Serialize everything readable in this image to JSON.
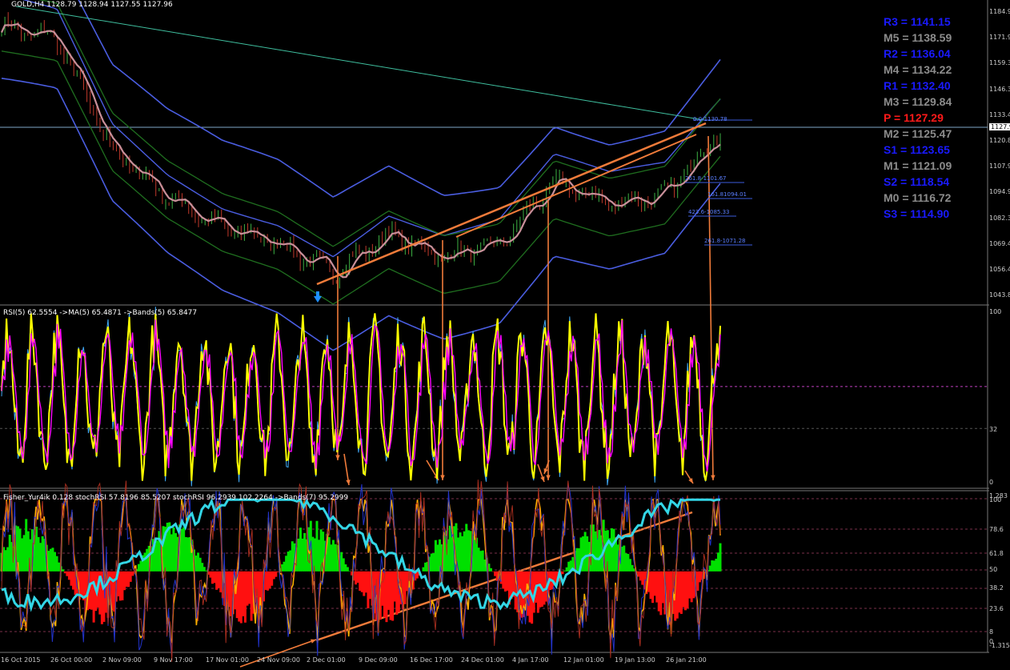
{
  "header": {
    "symbol_info": "GOLD,H4  1128.79 1128.94 1127.55 1127.96"
  },
  "indicators": {
    "rsi_title": "RSI(5) 62.5554  ->MA(5) 65.4871  ->Bands(5) 65.8477",
    "fisher_title": "Fisher_Yur4ik 0.128  stochRSI 57.8196 85.5207  stochRSI 96.2939 102.2264  ->Bands(7) 95.2999"
  },
  "pivots": [
    {
      "label": "R3 = 1141.15",
      "color": "#1a1aff"
    },
    {
      "label": "M5 = 1138.59",
      "color": "#8c8c8c"
    },
    {
      "label": "R2 = 1136.04",
      "color": "#1a1aff"
    },
    {
      "label": "M4 = 1134.22",
      "color": "#8c8c8c"
    },
    {
      "label": "R1 = 1132.40",
      "color": "#1a1aff"
    },
    {
      "label": "M3 = 1129.84",
      "color": "#8c8c8c"
    },
    {
      "label": "P   = 1127.29",
      "color": "#ff1a1a"
    },
    {
      "label": "M2 = 1125.47",
      "color": "#8c8c8c"
    },
    {
      "label": "S1 = 1123.65",
      "color": "#1a1aff"
    },
    {
      "label": "M1 = 1121.09",
      "color": "#8c8c8c"
    },
    {
      "label": "S2 = 1118.54",
      "color": "#1a1aff"
    },
    {
      "label": "M0 = 1116.72",
      "color": "#8c8c8c"
    },
    {
      "label": "S3 = 1114.90",
      "color": "#1a1aff"
    }
  ],
  "price_axis": [
    "1184.9",
    "1171.9",
    "1159.3",
    "1146.3",
    "1133.4",
    "1120.8",
    "1107.9",
    "1094.9",
    "1082.3",
    "1069.4",
    "1056.4",
    "1043.8"
  ],
  "current_price": "1127.9",
  "rsi_axis": [
    "100",
    "32",
    "0"
  ],
  "fisher_axis": [
    "1.283",
    "100",
    "78.6",
    "61.8",
    "50",
    "38.2",
    "23.6",
    "8",
    "0",
    "-1.315"
  ],
  "time_axis": [
    "16 Oct 2015",
    "26 Oct 00:00",
    "2 Nov 09:00",
    "9 Nov 17:00",
    "17 Nov 01:00",
    "24 Nov 09:00",
    "2 Dec 01:00",
    "9 Dec 09:00",
    "16 Dec 17:00",
    "24 Dec 01:00",
    "4 Jan 17:00",
    "12 Jan 01:00",
    "19 Jan 13:00",
    "26 Jan 21:00"
  ],
  "fib_labels": [
    "0.0-1130.78",
    "261.8-1101.67",
    "161.81094.01",
    "423.6-1085.33",
    "261.8-1071.28"
  ],
  "chart_data": {
    "type": "line",
    "title": "GOLD,H4",
    "ylim": [
      1043.8,
      1184.9
    ],
    "x": [
      "16 Oct 2015",
      "26 Oct 00:00",
      "2 Nov 09:00",
      "9 Nov 17:00",
      "17 Nov 01:00",
      "24 Nov 09:00",
      "2 Dec 01:00",
      "9 Dec 09:00",
      "16 Dec 17:00",
      "24 Dec 01:00",
      "4 Jan 17:00",
      "12 Jan 01:00",
      "19 Jan 13:00",
      "26 Jan 21:00"
    ],
    "series": [
      {
        "values": [
          1178,
          1172,
          1118,
          1095,
          1080,
          1073,
          1058,
          1077,
          1066,
          1072,
          1102,
          1092,
          1096,
          1127
        ]
      }
    ]
  }
}
